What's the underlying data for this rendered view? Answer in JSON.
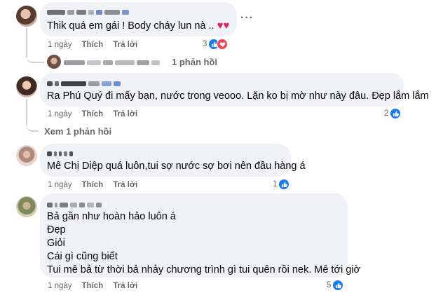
{
  "colors": {
    "like": "#1877f2",
    "love": "#f33e58",
    "bubble": "#f0f2f5",
    "meta": "#65676b"
  },
  "icons": {
    "like": "thumbs-up-icon",
    "love": "heart-icon",
    "more": "more-dots-icon"
  },
  "comments": [
    {
      "author": "",
      "text": "Thik quá em gái ! Body cháy lun nà .. ",
      "hearts": "♥♥",
      "time": "1 ngày",
      "like_label": "Thích",
      "reply_label": "Trả lời",
      "reaction_count": "3",
      "replies_label": "1 phản hồi"
    },
    {
      "author": "",
      "text": "Ra Phú Quý đi mấy bạn, nước trong veooo. Lặn ko bị mờ như này đâu. Đẹp lắm lắm",
      "time": "1 ngày",
      "like_label": "Thích",
      "reply_label": "Trả lời",
      "reaction_count": "2",
      "replies_label": "Xem 1 phản hồi"
    },
    {
      "author": "",
      "text": "Mê Chị Diệp quá luôn,tui sợ nước sợ bơi nên đầu hàng á",
      "time": "1 ngày",
      "like_label": "Thích",
      "reply_label": "Trả lời",
      "reaction_count": "1"
    },
    {
      "author": "",
      "lines": [
        "Bả gần như hoàn hảo luôn á",
        "Đẹp",
        "Giỏi",
        "Cái gì cũng biết",
        "Tui mê bả từ thời bả nhảy chương trình gì tui quên rồi nek. Mê tới giờ"
      ],
      "time": "1 ngày",
      "like_label": "Thích",
      "reply_label": "Trả lời",
      "reaction_count": "5"
    }
  ],
  "more_menu": "···"
}
